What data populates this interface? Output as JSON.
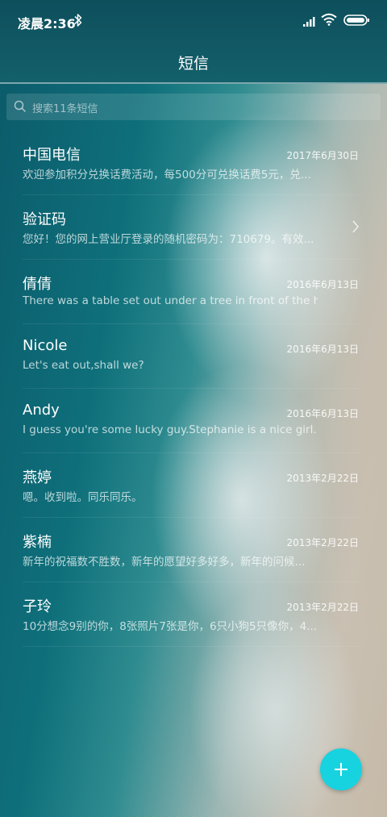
{
  "status": {
    "time": "凌晨2:36"
  },
  "header": {
    "title": "短信"
  },
  "search": {
    "placeholder": "搜索11条短信"
  },
  "conversations": [
    {
      "name": "中国电信",
      "date": "2017年6月30日",
      "preview": "欢迎参加积分兑换话费活动，每500分可兑换话费5元，兑..."
    },
    {
      "name": "验证码",
      "date": "",
      "preview": "您好！您的网上营业厅登录的随机密码为：710679。有效..."
    },
    {
      "name": "倩倩",
      "date": "2016年6月13日",
      "preview": "There was a table set out under a tree in front of the h..."
    },
    {
      "name": "Nicole",
      "date": "2016年6月13日",
      "preview": "Let's eat out,shall we?"
    },
    {
      "name": "Andy",
      "date": "2016年6月13日",
      "preview": "I guess you're some lucky guy.Stephanie is a nice girl."
    },
    {
      "name": "燕婷",
      "date": "2013年2月22日",
      "preview": "嗯。收到啦。同乐同乐。"
    },
    {
      "name": "紫楠",
      "date": "2013年2月22日",
      "preview": "新年的祝福数不胜数，新年的愿望好多好多，新年的问候..."
    },
    {
      "name": "子玲",
      "date": "2013年2月22日",
      "preview": "10分想念9别的你，8张照片7张是你，6只小狗5只像你，4..."
    }
  ],
  "icons": {
    "bluetooth": "bluetooth-icon",
    "signal": "signal-icon",
    "wifi": "wifi-icon",
    "battery": "battery-icon",
    "search": "search-icon",
    "chevron": "chevron-right-icon",
    "compose": "plus-icon"
  },
  "colors": {
    "header": "#0e4f5c",
    "fab": "#17d3e0",
    "text": "#ffffff"
  }
}
